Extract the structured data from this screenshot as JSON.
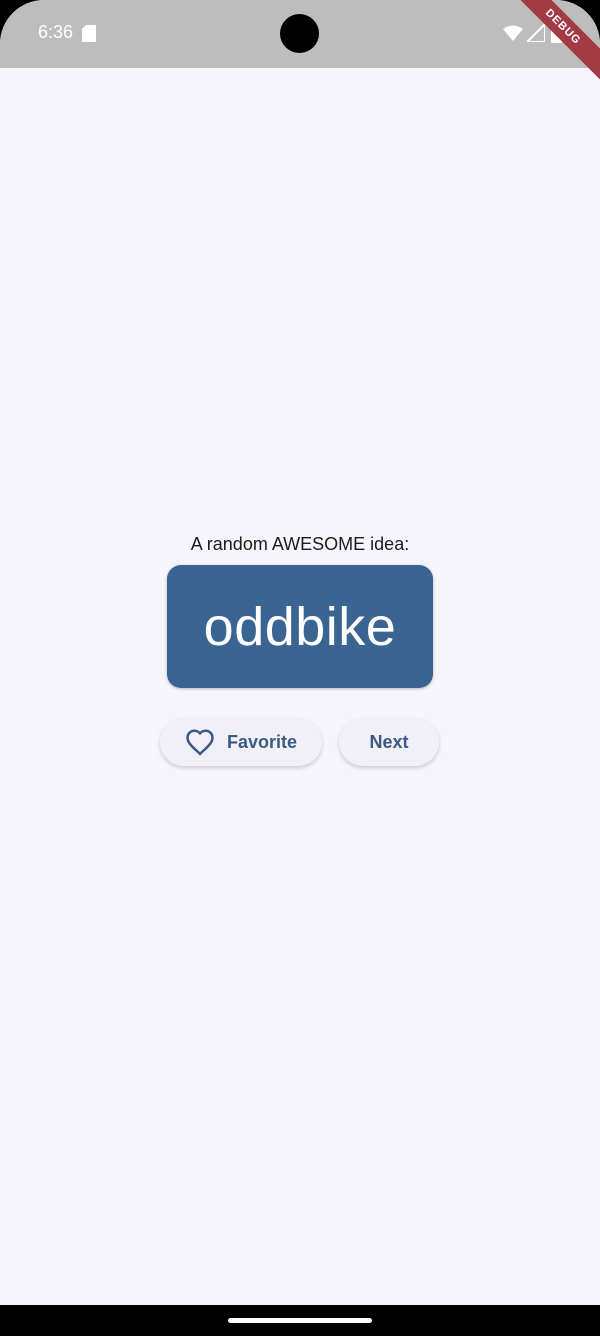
{
  "status_bar": {
    "time": "6:36",
    "icons": [
      "sd-card-icon",
      "wifi-icon",
      "signal-icon",
      "battery-icon"
    ],
    "background": "#bdbdbd"
  },
  "debug_banner": {
    "label": "DEBUG",
    "color": "#a33b45"
  },
  "main": {
    "subtitle": "A random AWESOME idea:",
    "idea": "oddbike",
    "card_color": "#3a6491",
    "background": "#f7f5fc"
  },
  "actions": {
    "favorite_label": "Favorite",
    "favorite_icon": "heart-outline-icon",
    "next_label": "Next",
    "text_color": "#3a5a82"
  }
}
